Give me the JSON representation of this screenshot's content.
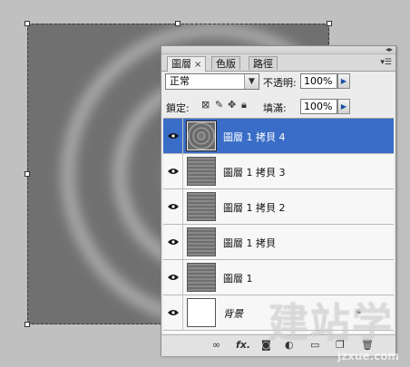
{
  "panel": {
    "tabs": [
      {
        "label": "圖層",
        "active": true,
        "closable": true
      },
      {
        "label": "色版",
        "active": false
      },
      {
        "label": "路徑",
        "active": false
      }
    ],
    "blend_mode": "正常",
    "opacity_label": "不透明:",
    "opacity_value": "100%",
    "lock_label": "鎖定:",
    "fill_label": "填滿:",
    "fill_value": "100%"
  },
  "layers": [
    {
      "name": "圖層 1 拷貝 4",
      "selected": true,
      "thumb": "ring"
    },
    {
      "name": "圖層 1 拷貝 3",
      "selected": false,
      "thumb": "stripes"
    },
    {
      "name": "圖層 1 拷貝 2",
      "selected": false,
      "thumb": "stripes"
    },
    {
      "name": "圖層 1 拷貝",
      "selected": false,
      "thumb": "stripes"
    },
    {
      "name": "圖層 1",
      "selected": false,
      "thumb": "stripes"
    },
    {
      "name": "背景",
      "selected": false,
      "thumb": "white",
      "locked": true
    }
  ],
  "bottom_icons": [
    "link-icon",
    "fx-icon",
    "mask-icon",
    "adjustment-icon",
    "group-icon",
    "new-layer-icon",
    "trash-icon"
  ],
  "bottom_fx": "fx.",
  "watermark": {
    "main": "建站学",
    "sub": "jzxue.com"
  },
  "colors": {
    "selection": "#3a6dc7",
    "canvas": "#707070",
    "ring_light": "#b8b8b8"
  }
}
